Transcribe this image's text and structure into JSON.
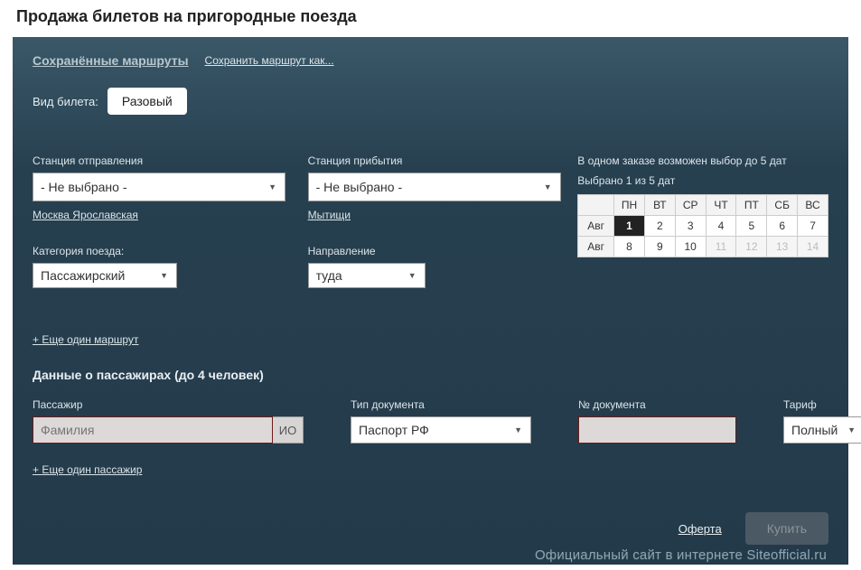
{
  "page_title": "Продажа билетов на пригородные поезда",
  "top": {
    "saved_routes": "Сохранённые маршруты",
    "save_as": "Сохранить маршрут как..."
  },
  "ticket_type": {
    "label": "Вид билета:",
    "value": "Разовый"
  },
  "departure": {
    "label": "Станция отправления",
    "selected": "- Не выбрано -",
    "quick": "Москва Ярославская"
  },
  "arrival": {
    "label": "Станция прибытия",
    "selected": "- Не выбрано -",
    "quick": "Мытищи"
  },
  "train_category": {
    "label": "Категория поезда:",
    "selected": "Пассажирский"
  },
  "direction": {
    "label": "Направление",
    "selected": "туда"
  },
  "calendar": {
    "note1": "В одном заказе возможен выбор до 5 дат",
    "note2": "Выбрано 1 из 5 дат",
    "weekdays": [
      "ПН",
      "ВТ",
      "СР",
      "ЧТ",
      "ПТ",
      "СБ",
      "ВС"
    ],
    "month": "Авг",
    "rows": [
      {
        "days": [
          {
            "d": "1",
            "sel": true
          },
          {
            "d": "2"
          },
          {
            "d": "3"
          },
          {
            "d": "4"
          },
          {
            "d": "5"
          },
          {
            "d": "6"
          },
          {
            "d": "7"
          }
        ]
      },
      {
        "days": [
          {
            "d": "8"
          },
          {
            "d": "9"
          },
          {
            "d": "10"
          },
          {
            "d": "11",
            "dis": true
          },
          {
            "d": "12",
            "dis": true
          },
          {
            "d": "13",
            "dis": true
          },
          {
            "d": "14",
            "dis": true
          }
        ]
      }
    ]
  },
  "add_route": "+ Еще один маршрут",
  "passengers": {
    "title": "Данные о пассажирах (до 4 человек)",
    "col_passenger": "Пассажир",
    "col_doctype": "Тип документа",
    "col_docnum": "№ документа",
    "col_tariff": "Тариф",
    "surname_placeholder": "Фамилия",
    "io": "ИО",
    "doctype_selected": "Паспорт РФ",
    "docnum_value": "",
    "tariff_selected": "Полный"
  },
  "add_passenger": "+ Еще один пассажир",
  "footer": {
    "oferta": "Оферта",
    "buy": "Купить"
  },
  "watermark": "Официальный сайт в интернете Siteofficial.ru"
}
